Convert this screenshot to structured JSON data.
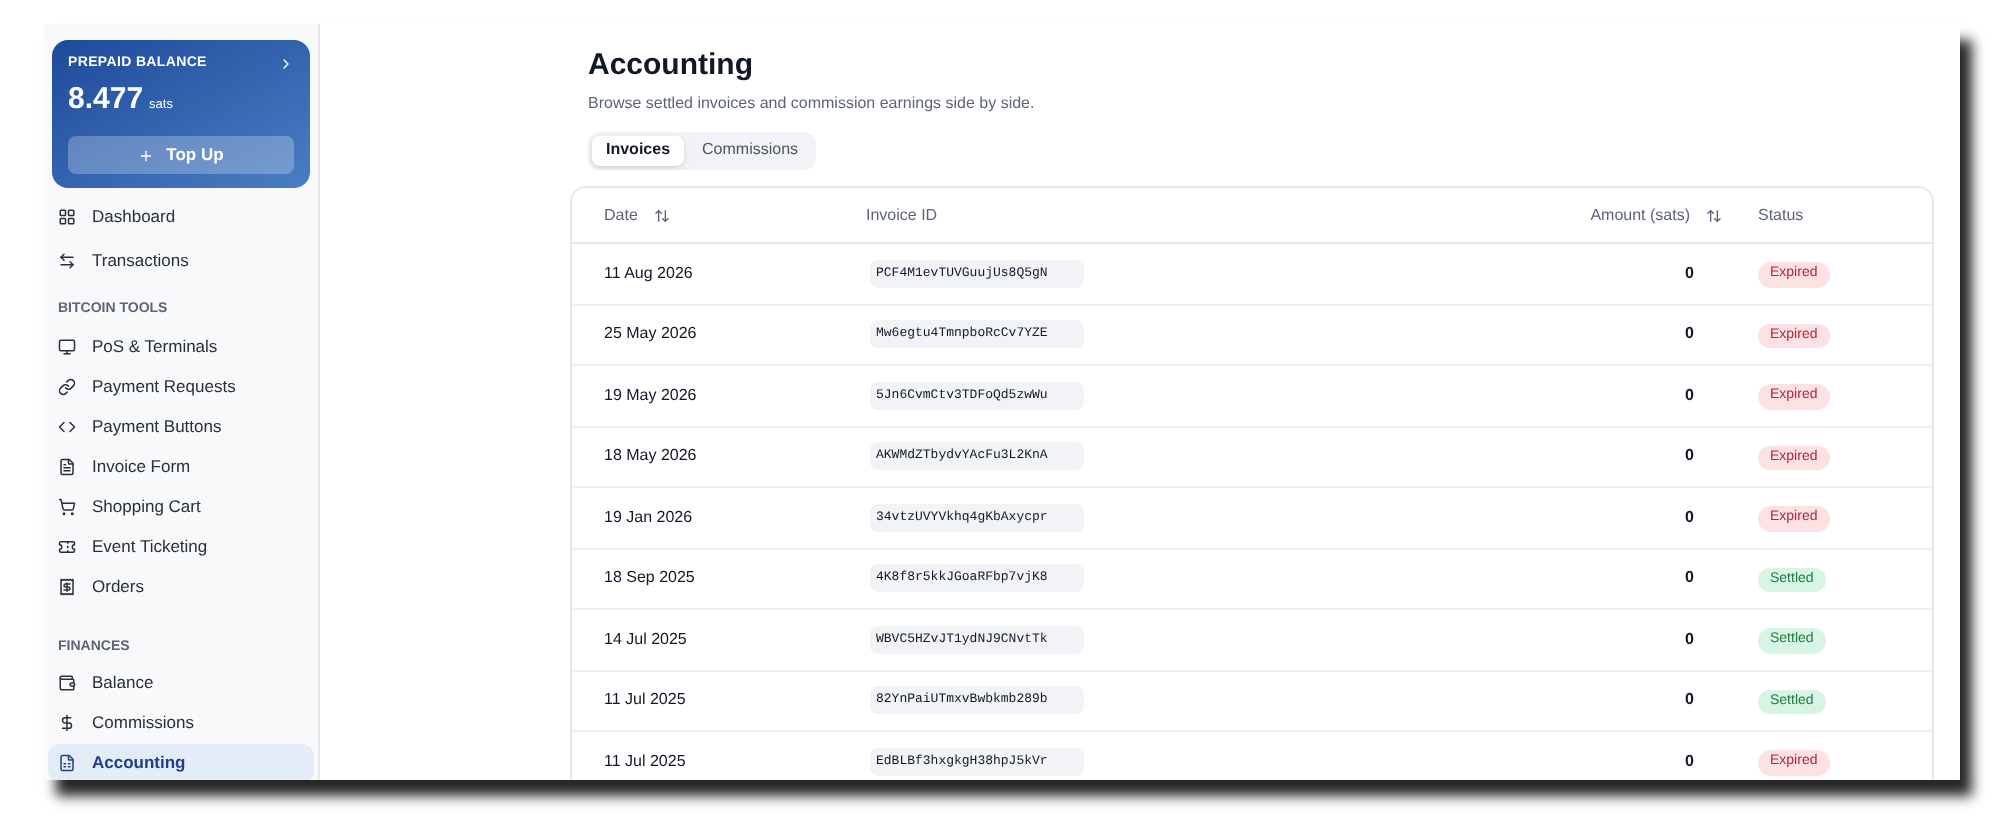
{
  "balance_card": {
    "title": "PREPAID BALANCE",
    "amount": "8.477",
    "unit": "sats",
    "button": "Top Up"
  },
  "sidebar": {
    "items": [
      {
        "label": "Dashboard",
        "selected": false
      },
      {
        "label": "Transactions",
        "selected": false
      }
    ],
    "sections": [
      {
        "title": "BITCOIN TOOLS",
        "items": [
          {
            "label": "PoS & Terminals",
            "selected": false
          },
          {
            "label": "Payment Requests",
            "selected": false
          },
          {
            "label": "Payment Buttons",
            "selected": false
          },
          {
            "label": "Invoice Form",
            "selected": false
          },
          {
            "label": "Shopping Cart",
            "selected": false
          },
          {
            "label": "Event Ticketing",
            "selected": false
          },
          {
            "label": "Orders",
            "selected": false
          }
        ]
      },
      {
        "title": "FINANCES",
        "items": [
          {
            "label": "Balance",
            "selected": false
          },
          {
            "label": "Commissions",
            "selected": false
          },
          {
            "label": "Accounting",
            "selected": true
          }
        ]
      }
    ]
  },
  "page": {
    "title": "Accounting",
    "subtitle": "Browse settled invoices and commission earnings side by side."
  },
  "tabs": [
    {
      "label": "Invoices",
      "selected": true
    },
    {
      "label": "Commissions",
      "selected": false
    }
  ],
  "table": {
    "columns": [
      {
        "label": "Date",
        "sortable": true
      },
      {
        "label": "Invoice ID",
        "sortable": false
      },
      {
        "label": "Amount (sats)",
        "sortable": true
      },
      {
        "label": "Status",
        "sortable": false
      }
    ],
    "rows": [
      {
        "date": "11 Aug 2026",
        "invoice_id": "PCF4M1evTUVGuujUs8Q5gN",
        "amount": "0",
        "status": "Expired",
        "kind": "expired"
      },
      {
        "date": "25 May 2026",
        "invoice_id": "Mw6egtu4TmnpboRcCv7YZE",
        "amount": "0",
        "status": "Expired",
        "kind": "expired"
      },
      {
        "date": "19 May 2026",
        "invoice_id": "5Jn6CvmCtv3TDFoQd5zwWu",
        "amount": "0",
        "status": "Expired",
        "kind": "expired"
      },
      {
        "date": "18 May 2026",
        "invoice_id": "AKWMdZTbydvYAcFu3L2KnA",
        "amount": "0",
        "status": "Expired",
        "kind": "expired"
      },
      {
        "date": "19 Jan 2026",
        "invoice_id": "34vtzUVYVkhq4gKbAxycpr",
        "amount": "0",
        "status": "Expired",
        "kind": "expired"
      },
      {
        "date": "18 Sep 2025",
        "invoice_id": "4K8f8r5kkJGoaRFbp7vjK8",
        "amount": "0",
        "status": "Settled",
        "kind": "settled"
      },
      {
        "date": "14 Jul 2025",
        "invoice_id": "WBVC5HZvJT1ydNJ9CNvtTk",
        "amount": "0",
        "status": "Settled",
        "kind": "settled"
      },
      {
        "date": "11 Jul 2025",
        "invoice_id": "82YnPaiUTmxvBwbkmb289b",
        "amount": "0",
        "status": "Settled",
        "kind": "settled"
      },
      {
        "date": "11 Jul 2025",
        "invoice_id": "EdBLBf3hxgkgH38hpJ5kVr",
        "amount": "0",
        "status": "Expired",
        "kind": "expired"
      }
    ]
  }
}
